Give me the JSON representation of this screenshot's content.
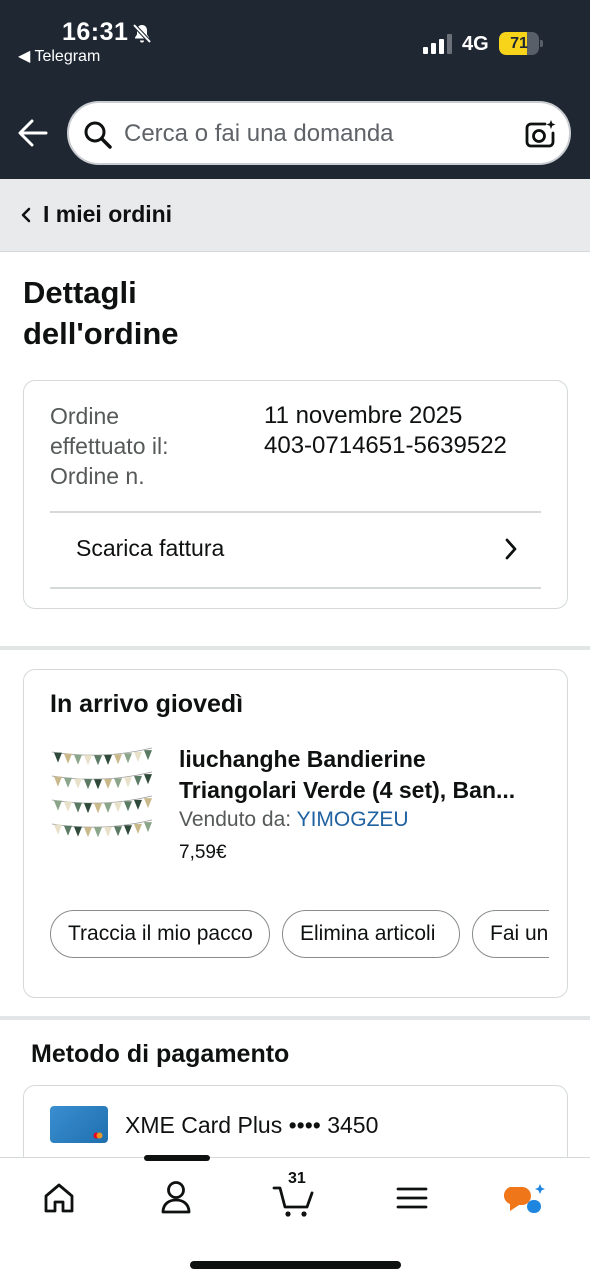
{
  "status_bar": {
    "time": "16:31",
    "back_app": "◀ Telegram",
    "network": "4G",
    "battery": "71",
    "battery_level": 0.71
  },
  "search": {
    "placeholder": "Cerca o fai una domanda"
  },
  "breadcrumb": {
    "label": "I miei ordini"
  },
  "page": {
    "title": "Dettagli dell'ordine"
  },
  "order": {
    "placed_label": "Ordine effettuato il:",
    "number_label": "Ordine n.",
    "date": "11 novembre 2025",
    "number": "403-0714651-5639522",
    "invoice_label": "Scarica fattura"
  },
  "shipment": {
    "arrival": "In arrivo giovedì",
    "product_name": "liuchanghe Bandierine Triangolari Verde (4 set), Ban...",
    "sold_by_label": "Venduto da: ",
    "seller": "YIMOGZEU",
    "price": "7,59€",
    "actions": [
      "Traccia il mio pacco",
      "Elimina articoli",
      "Fai un"
    ]
  },
  "payment": {
    "title": "Metodo di pagamento",
    "card": "XME Card Plus •••• 3450"
  },
  "bottom_nav": {
    "cart_count": "31",
    "items": [
      "home-icon",
      "account-icon",
      "cart-icon",
      "menu-icon",
      "rufus-icon"
    ]
  },
  "colors": {
    "header_bg": "#1f2733",
    "link": "#2162a1",
    "battery": "#f7d31a",
    "crumb_bg": "#e8eaeb"
  }
}
